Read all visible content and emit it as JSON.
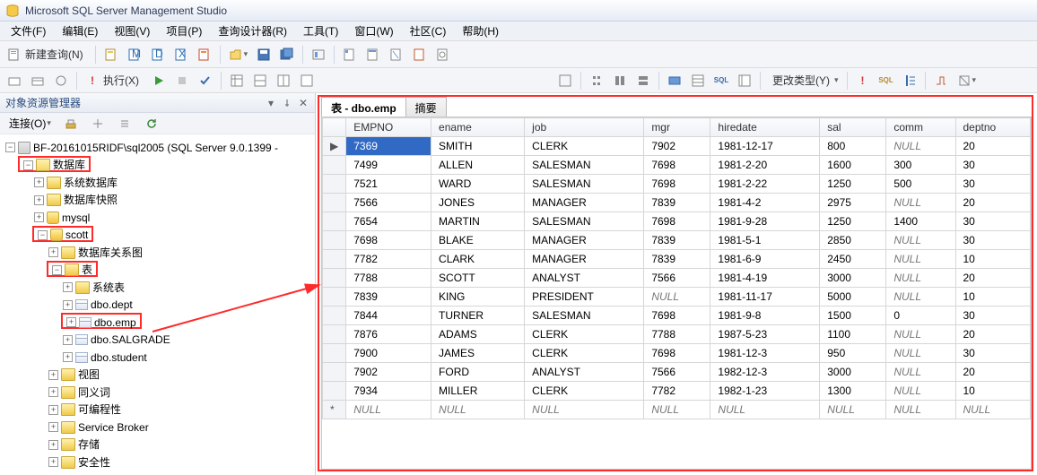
{
  "window": {
    "title": "Microsoft SQL Server Management Studio"
  },
  "menu": {
    "file": "文件(F)",
    "edit": "编辑(E)",
    "view": "视图(V)",
    "project": "项目(P)",
    "querydesigner": "查询设计器(R)",
    "tools": "工具(T)",
    "window": "窗口(W)",
    "community": "社区(C)",
    "help": "帮助(H)"
  },
  "toolbar": {
    "newquery": "新建查询(N)",
    "execute": "执行(X)",
    "changetype": "更改类型(Y)"
  },
  "objexplorer": {
    "title": "对象资源管理器",
    "connect": "连接(O)",
    "root": "BF-20161015RIDF\\sql2005 (SQL Server 9.0.1399 -",
    "databases": "数据库",
    "sysdb": "系统数据库",
    "dbsnap": "数据库快照",
    "mysql": "mysql",
    "scott": "scott",
    "diagrams": "数据库关系图",
    "tables": "表",
    "systables": "系统表",
    "dept": "dbo.dept",
    "emp": "dbo.emp",
    "salgrade": "dbo.SALGRADE",
    "student": "dbo.student",
    "views": "视图",
    "synonyms": "同义词",
    "programmability": "可编程性",
    "servicebroker": "Service Broker",
    "storage": "存储",
    "security": "安全性"
  },
  "tabs": {
    "active": "表 - dbo.emp",
    "summary": "摘要"
  },
  "columns": [
    "EMPNO",
    "ename",
    "job",
    "mgr",
    "hiredate",
    "sal",
    "comm",
    "deptno"
  ],
  "rows": [
    {
      "sel": true,
      "marker": "▶",
      "c": [
        "7369",
        "SMITH",
        "CLERK",
        "7902",
        "1981-12-17",
        "800",
        null,
        "20"
      ]
    },
    {
      "c": [
        "7499",
        "ALLEN",
        "SALESMAN",
        "7698",
        "1981-2-20",
        "1600",
        "300",
        "30"
      ]
    },
    {
      "c": [
        "7521",
        "WARD",
        "SALESMAN",
        "7698",
        "1981-2-22",
        "1250",
        "500",
        "30"
      ]
    },
    {
      "c": [
        "7566",
        "JONES",
        "MANAGER",
        "7839",
        "1981-4-2",
        "2975",
        null,
        "20"
      ]
    },
    {
      "c": [
        "7654",
        "MARTIN",
        "SALESMAN",
        "7698",
        "1981-9-28",
        "1250",
        "1400",
        "30"
      ]
    },
    {
      "c": [
        "7698",
        "BLAKE",
        "MANAGER",
        "7839",
        "1981-5-1",
        "2850",
        null,
        "30"
      ]
    },
    {
      "c": [
        "7782",
        "CLARK",
        "MANAGER",
        "7839",
        "1981-6-9",
        "2450",
        null,
        "10"
      ]
    },
    {
      "c": [
        "7788",
        "SCOTT",
        "ANALYST",
        "7566",
        "1981-4-19",
        "3000",
        null,
        "20"
      ]
    },
    {
      "c": [
        "7839",
        "KING",
        "PRESIDENT",
        null,
        "1981-11-17",
        "5000",
        null,
        "10"
      ]
    },
    {
      "c": [
        "7844",
        "TURNER",
        "SALESMAN",
        "7698",
        "1981-9-8",
        "1500",
        "0",
        "30"
      ]
    },
    {
      "c": [
        "7876",
        "ADAMS",
        "CLERK",
        "7788",
        "1987-5-23",
        "1100",
        null,
        "20"
      ]
    },
    {
      "c": [
        "7900",
        "JAMES",
        "CLERK",
        "7698",
        "1981-12-3",
        "950",
        null,
        "30"
      ]
    },
    {
      "c": [
        "7902",
        "FORD",
        "ANALYST",
        "7566",
        "1982-12-3",
        "3000",
        null,
        "20"
      ]
    },
    {
      "c": [
        "7934",
        "MILLER",
        "CLERK",
        "7782",
        "1982-1-23",
        "1300",
        null,
        "10"
      ]
    },
    {
      "marker": "*",
      "c": [
        null,
        null,
        null,
        null,
        null,
        null,
        null,
        null
      ]
    }
  ],
  "nulltext": "NULL"
}
